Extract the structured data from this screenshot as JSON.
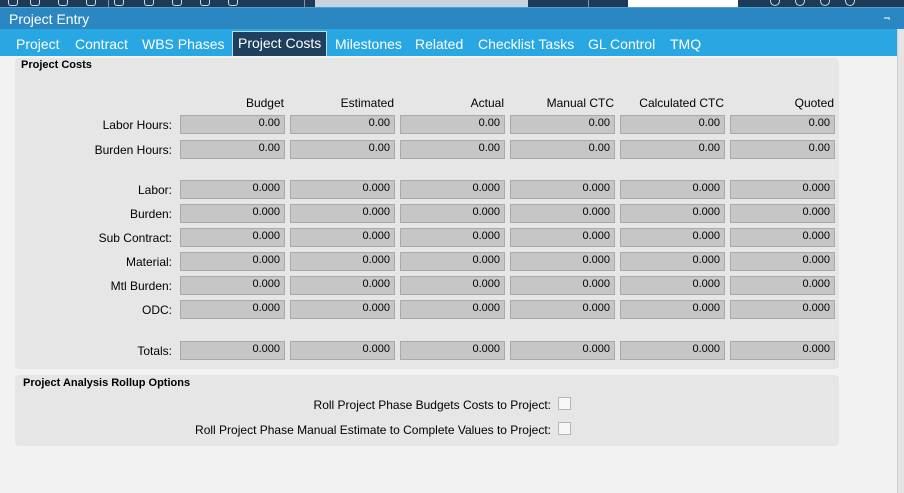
{
  "window": {
    "title": "Project Entry",
    "pin_glyph": "⫬"
  },
  "toolbar": {
    "icons": [
      "save-icon",
      "undo-icon",
      "copy-icon",
      "print-icon",
      "attach-icon",
      "tasks-icon",
      "search-icon",
      "settings-icon",
      "help-icon"
    ]
  },
  "tabs": [
    "Project",
    "Contract",
    "WBS Phases",
    "Project Costs",
    "Milestones",
    "Related",
    "Checklist Tasks",
    "GL Control",
    "TMQ"
  ],
  "active_tab": "Project Costs",
  "project_costs": {
    "group_title": "Project Costs",
    "columns": [
      "Budget",
      "Estimated",
      "Actual",
      "Manual CTC",
      "Calculated CTC",
      "Quoted"
    ],
    "rows": [
      {
        "label": "Labor Hours:",
        "values": [
          "0.00",
          "0.00",
          "0.00",
          "0.00",
          "0.00",
          "0.00"
        ]
      },
      {
        "label": "Burden Hours:",
        "values": [
          "0.00",
          "0.00",
          "0.00",
          "0.00",
          "0.00",
          "0.00"
        ]
      },
      {
        "label": "Labor:",
        "values": [
          "0.000",
          "0.000",
          "0.000",
          "0.000",
          "0.000",
          "0.000"
        ]
      },
      {
        "label": "Burden:",
        "values": [
          "0.000",
          "0.000",
          "0.000",
          "0.000",
          "0.000",
          "0.000"
        ]
      },
      {
        "label": "Sub Contract:",
        "values": [
          "0.000",
          "0.000",
          "0.000",
          "0.000",
          "0.000",
          "0.000"
        ]
      },
      {
        "label": "Material:",
        "values": [
          "0.000",
          "0.000",
          "0.000",
          "0.000",
          "0.000",
          "0.000"
        ]
      },
      {
        "label": "Mtl Burden:",
        "values": [
          "0.000",
          "0.000",
          "0.000",
          "0.000",
          "0.000",
          "0.000"
        ]
      },
      {
        "label": "ODC:",
        "values": [
          "0.000",
          "0.000",
          "0.000",
          "0.000",
          "0.000",
          "0.000"
        ]
      },
      {
        "label": "Totals:",
        "values": [
          "0.000",
          "0.000",
          "0.000",
          "0.000",
          "0.000",
          "0.000"
        ]
      }
    ]
  },
  "rollup": {
    "group_title": "Project Analysis Rollup Options",
    "options": [
      {
        "label": "Roll Project Phase Budgets Costs to Project:",
        "checked": false
      },
      {
        "label": "Roll Project Phase Manual Estimate to Complete Values to Project:",
        "checked": false
      }
    ]
  }
}
